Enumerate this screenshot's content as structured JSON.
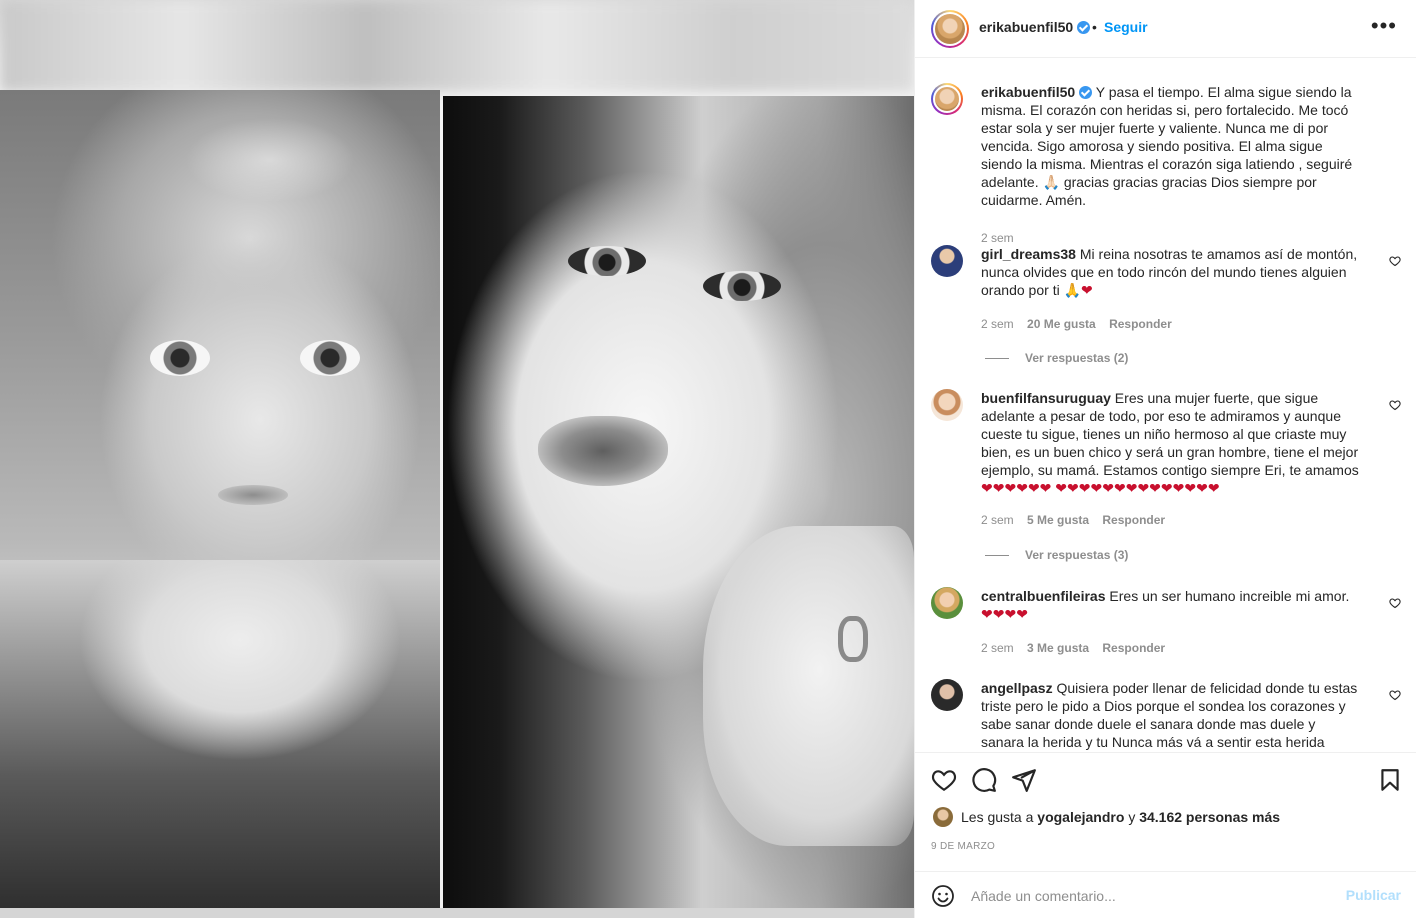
{
  "post": {
    "username": "erikabuenfil50",
    "follow_label": "Seguir",
    "dot": "•",
    "more_label": "•••",
    "caption": "Y pasa el tiempo. El alma sigue siendo la misma. El corazón con heridas si, pero fortalecido. Me tocó estar sola y ser mujer fuerte y valiente. Nunca me di por vencida. Sigo amorosa y siendo positiva. El alma sigue siendo la misma. Mientras el corazón siga latiendo , seguiré adelante. 🙏🏻 gracias gracias gracias Dios siempre por cuidarme. Amén.",
    "caption_time": "2 sem"
  },
  "comments": [
    {
      "username": "girl_dreams38",
      "text": "Mi reina nosotras te amamos así de montón, nunca olvides que en todo rincón del mundo tienes alguien orando por ti 🙏❤",
      "time": "2 sem",
      "likes": "20 Me gusta",
      "reply": "Responder",
      "view_replies": "Ver respuestas (2)"
    },
    {
      "username": "buenfilfansuruguay",
      "text": "Eres una mujer fuerte, que sigue adelante a pesar de todo, por eso te admiramos y aunque cueste tu sigue, tienes un niño hermoso al que criaste muy bien, es un buen chico y será un gran hombre, tiene el mejor ejemplo, su mamá. Estamos contigo siempre Eri, te amamos ❤❤❤❤❤❤ ❤❤❤❤❤❤❤❤❤❤❤❤❤❤",
      "time": "2 sem",
      "likes": "5 Me gusta",
      "reply": "Responder",
      "view_replies": "Ver respuestas (3)"
    },
    {
      "username": "centralbuenfileiras",
      "text": "Eres un ser humano increible mi amor. ❤❤❤❤",
      "time": "2 sem",
      "likes": "3 Me gusta",
      "reply": "Responder"
    },
    {
      "username": "angellpasz",
      "text": "Quisiera poder llenar de felicidad donde tu estas triste pero le pido a Dios porque el sondea los corazones y sabe sanar donde duele el sanara donde mas duele y sanara la herida y tu Nunca más vá a sentir esta herida palpitar💔🙏🏻🌸💛"
    }
  ],
  "likes_bar": {
    "prefix": "Les gusta a",
    "user": "yogalejandro",
    "middle": "y",
    "count": "34.162 personas más"
  },
  "date": "9 DE MARZO",
  "add_comment": {
    "placeholder": "Añade un comentario...",
    "publish": "Publicar"
  },
  "icons": [
    "heart-icon",
    "comment-icon",
    "share-icon",
    "bookmark-icon",
    "emoji-icon",
    "verified-icon",
    "more-icon"
  ],
  "colors": {
    "link": "#0095f6",
    "publish_disabled": "#b2dffc",
    "muted": "#8e8e8e",
    "verified": "#3897f0"
  }
}
